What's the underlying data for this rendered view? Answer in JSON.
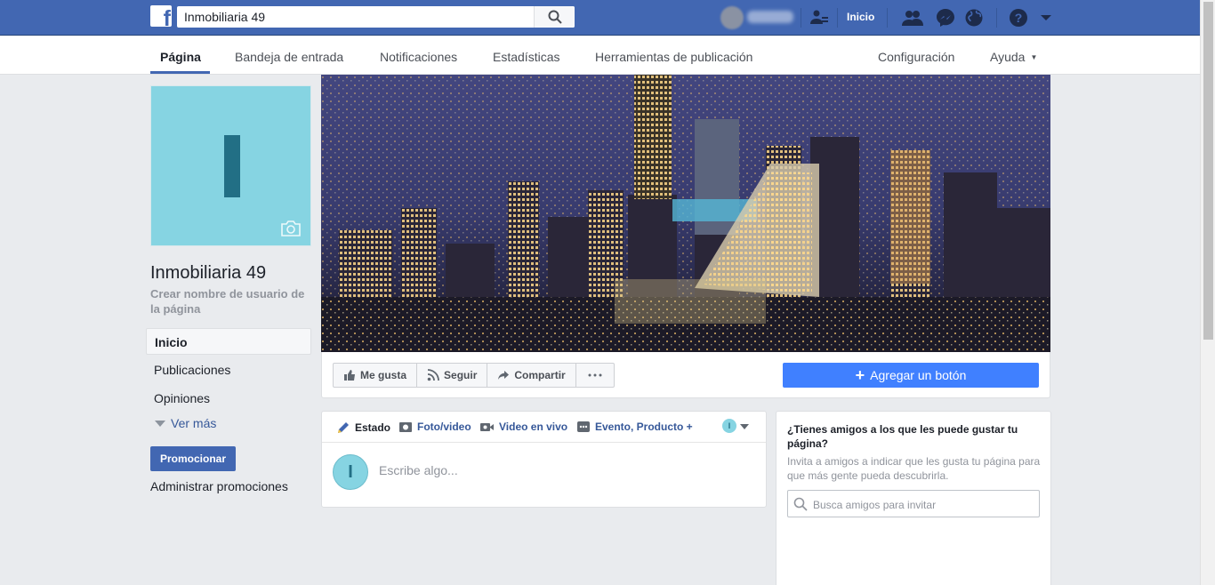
{
  "topbar": {
    "search_value": "Inmobiliaria 49",
    "home_label": "Inicio",
    "icons": [
      "facebook-logo",
      "search-icon",
      "find-friends-icon",
      "friend-requests-icon",
      "messenger-icon",
      "globe-notifications-icon",
      "help-icon",
      "menu-caret-icon"
    ]
  },
  "pagenav": {
    "items": [
      "Página",
      "Bandeja de entrada",
      "Notificaciones",
      "Estadísticas",
      "Herramientas de publicación"
    ],
    "active": "Página",
    "settings": "Configuración",
    "help": "Ayuda"
  },
  "profile": {
    "initial": "I",
    "page_name": "Inmobiliaria 49",
    "username_link": "Crear nombre de usuario de la página"
  },
  "left_nav": {
    "items": [
      "Inicio",
      "Publicaciones",
      "Opiniones"
    ],
    "more": "Ver más",
    "promote": "Promocionar",
    "manage_promotions": "Administrar promociones"
  },
  "actions": {
    "like": "Me gusta",
    "follow": "Seguir",
    "share": "Compartir",
    "add_button": "Agregar un botón"
  },
  "composer": {
    "tabs": [
      "Estado",
      "Foto/video",
      "Video en vivo",
      "Evento, Producto +"
    ],
    "placeholder": "Escribe algo...",
    "avatar_initial": "I"
  },
  "invite": {
    "title": "¿Tienes amigos a los que les puede gustar tu página?",
    "description": "Invita a amigos a indicar que les gusta tu página para que más gente pueda descubrirla.",
    "search_placeholder": "Busca amigos para invitar"
  },
  "colors": {
    "brand_blue": "#4267b2",
    "button_blue": "#4080ff",
    "avatar_bg": "#86d4e2",
    "avatar_letter": "#226f85",
    "page_bg": "#e9ebee"
  }
}
